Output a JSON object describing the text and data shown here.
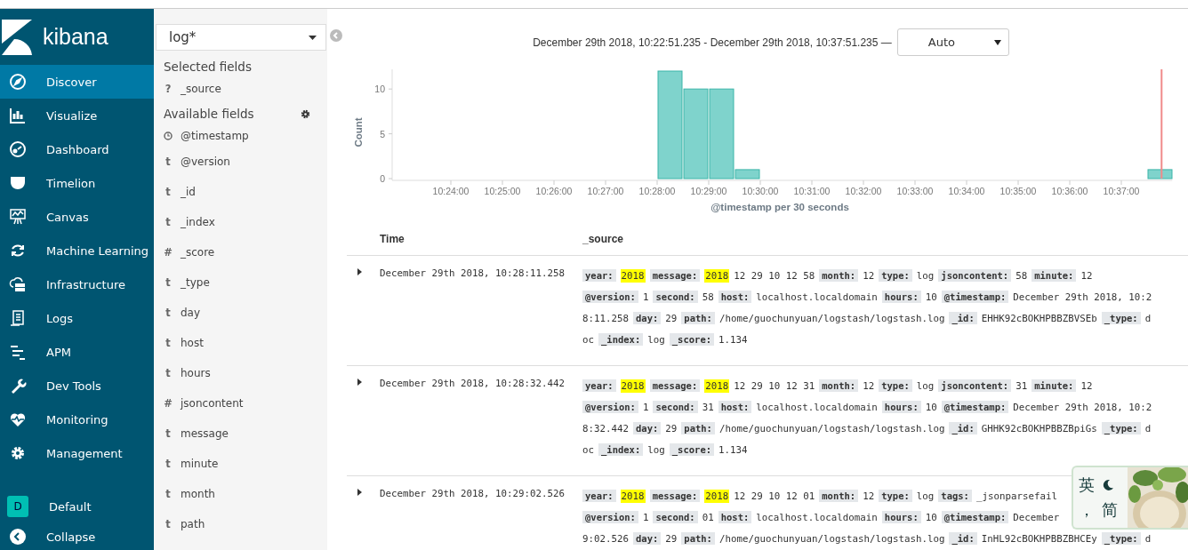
{
  "sidebar": {
    "logo_text": "kibana",
    "items": [
      {
        "label": "Discover",
        "selected": true
      },
      {
        "label": "Visualize",
        "selected": false
      },
      {
        "label": "Dashboard",
        "selected": false
      },
      {
        "label": "Timelion",
        "selected": false
      },
      {
        "label": "Canvas",
        "selected": false
      },
      {
        "label": "Machine Learning",
        "selected": false
      },
      {
        "label": "Infrastructure",
        "selected": false
      },
      {
        "label": "Logs",
        "selected": false
      },
      {
        "label": "APM",
        "selected": false
      },
      {
        "label": "Dev Tools",
        "selected": false
      },
      {
        "label": "Monitoring",
        "selected": false
      },
      {
        "label": "Management",
        "selected": false
      }
    ],
    "space": {
      "initial": "D",
      "label": "Default"
    },
    "collapse_label": "Collapse"
  },
  "fields_panel": {
    "index_pattern": "log*",
    "selected_heading": "Selected fields",
    "selected_fields": [
      {
        "kind": "typed",
        "symbol": "?",
        "name": "_source"
      }
    ],
    "available_heading": "Available fields",
    "available_fields": [
      {
        "kind": "date",
        "name": "@timestamp"
      },
      {
        "kind": "typed",
        "symbol": "t",
        "name": "@version"
      },
      {
        "kind": "typed",
        "symbol": "t",
        "name": "_id"
      },
      {
        "kind": "typed",
        "symbol": "t",
        "name": "_index"
      },
      {
        "kind": "typed",
        "symbol": "#",
        "name": "_score"
      },
      {
        "kind": "typed",
        "symbol": "t",
        "name": "_type"
      },
      {
        "kind": "typed",
        "symbol": "t",
        "name": "day"
      },
      {
        "kind": "typed",
        "symbol": "t",
        "name": "host"
      },
      {
        "kind": "typed",
        "symbol": "t",
        "name": "hours"
      },
      {
        "kind": "typed",
        "symbol": "#",
        "name": "jsoncontent"
      },
      {
        "kind": "typed",
        "symbol": "t",
        "name": "message"
      },
      {
        "kind": "typed",
        "symbol": "t",
        "name": "minute"
      },
      {
        "kind": "typed",
        "symbol": "t",
        "name": "month"
      },
      {
        "kind": "typed",
        "symbol": "t",
        "name": "path"
      }
    ]
  },
  "histogram": {
    "time_range": "December 29th 2018, 10:22:51.235 - December 29th 2018, 10:37:51.235 —",
    "interval": "Auto",
    "chart_data": {
      "type": "bar",
      "ylabel": "Count",
      "xlabel": "@timestamp per 30 seconds",
      "categories": [
        null,
        null,
        "10:24:00",
        null,
        "10:25:00",
        null,
        "10:26:00",
        null,
        "10:27:00",
        null,
        "10:28:00",
        null,
        "10:29:00",
        null,
        "10:30:00",
        null,
        "10:31:00",
        null,
        "10:32:00",
        null,
        "10:33:00",
        null,
        "10:34:00",
        null,
        "10:35:00",
        null,
        "10:36:00",
        null,
        "10:37:00",
        null
      ],
      "series": [
        {
          "color": "#7fd3cc",
          "values": [
            0,
            0,
            0,
            0,
            0,
            0,
            0,
            0,
            0,
            0,
            12,
            10,
            10,
            1,
            0,
            0,
            0,
            0,
            0,
            0,
            0,
            0,
            0,
            0,
            0,
            0,
            0,
            0,
            0,
            1
          ]
        }
      ],
      "ylim": [
        0,
        12
      ],
      "yticks": [
        0,
        5,
        10
      ]
    }
  },
  "table": {
    "columns": [
      "Time",
      "_source"
    ],
    "rows": [
      {
        "time": "December 29th 2018, 10:28:11.258",
        "lines": [
          [
            {
              "kind": "key",
              "text": "year:"
            },
            {
              "kind": "mark",
              "text": "2018"
            },
            {
              "kind": "key",
              "text": "message:"
            },
            {
              "kind": "mark",
              "text": "2018"
            },
            {
              "kind": "value",
              "text": "12 29 10 12 58"
            },
            {
              "kind": "key",
              "text": "month:"
            },
            {
              "kind": "value",
              "text": "12"
            },
            {
              "kind": "key",
              "text": "type:"
            },
            {
              "kind": "value",
              "text": "log"
            },
            {
              "kind": "key",
              "text": "jsoncontent:"
            },
            {
              "kind": "value",
              "text": "58"
            },
            {
              "kind": "key",
              "text": "minute:"
            },
            {
              "kind": "value",
              "text": "12"
            }
          ],
          [
            {
              "kind": "key",
              "text": "@version:"
            },
            {
              "kind": "value",
              "text": "1"
            },
            {
              "kind": "key",
              "text": "second:"
            },
            {
              "kind": "value",
              "text": "58"
            },
            {
              "kind": "key",
              "text": "host:"
            },
            {
              "kind": "value",
              "text": "localhost.localdomain"
            },
            {
              "kind": "key",
              "text": "hours:"
            },
            {
              "kind": "value",
              "text": "10"
            },
            {
              "kind": "key",
              "text": "@timestamp:"
            },
            {
              "kind": "value",
              "text": "December 29th 2018, 10:2"
            }
          ],
          [
            {
              "kind": "value",
              "text": "8:11.258"
            },
            {
              "kind": "key",
              "text": "day:"
            },
            {
              "kind": "value",
              "text": "29"
            },
            {
              "kind": "key",
              "text": "path:"
            },
            {
              "kind": "value",
              "text": "/home/guochunyuan/logstash/logstash.log"
            },
            {
              "kind": "key",
              "text": "_id:"
            },
            {
              "kind": "value",
              "text": "EHHK92cBOKHPBBZBVSEb"
            },
            {
              "kind": "key",
              "text": "_type:"
            },
            {
              "kind": "value",
              "text": "d"
            }
          ],
          [
            {
              "kind": "value",
              "text": "oc"
            },
            {
              "kind": "key",
              "text": "_index:"
            },
            {
              "kind": "value",
              "text": "log"
            },
            {
              "kind": "key",
              "text": "_score:"
            },
            {
              "kind": "value",
              "text": "1.134"
            }
          ]
        ]
      },
      {
        "time": "December 29th 2018, 10:28:32.442",
        "lines": [
          [
            {
              "kind": "key",
              "text": "year:"
            },
            {
              "kind": "mark",
              "text": "2018"
            },
            {
              "kind": "key",
              "text": "message:"
            },
            {
              "kind": "mark",
              "text": "2018"
            },
            {
              "kind": "value",
              "text": "12 29 10 12 31"
            },
            {
              "kind": "key",
              "text": "month:"
            },
            {
              "kind": "value",
              "text": "12"
            },
            {
              "kind": "key",
              "text": "type:"
            },
            {
              "kind": "value",
              "text": "log"
            },
            {
              "kind": "key",
              "text": "jsoncontent:"
            },
            {
              "kind": "value",
              "text": "31"
            },
            {
              "kind": "key",
              "text": "minute:"
            },
            {
              "kind": "value",
              "text": "12"
            }
          ],
          [
            {
              "kind": "key",
              "text": "@version:"
            },
            {
              "kind": "value",
              "text": "1"
            },
            {
              "kind": "key",
              "text": "second:"
            },
            {
              "kind": "value",
              "text": "31"
            },
            {
              "kind": "key",
              "text": "host:"
            },
            {
              "kind": "value",
              "text": "localhost.localdomain"
            },
            {
              "kind": "key",
              "text": "hours:"
            },
            {
              "kind": "value",
              "text": "10"
            },
            {
              "kind": "key",
              "text": "@timestamp:"
            },
            {
              "kind": "value",
              "text": "December 29th 2018, 10:2"
            }
          ],
          [
            {
              "kind": "value",
              "text": "8:32.442"
            },
            {
              "kind": "key",
              "text": "day:"
            },
            {
              "kind": "value",
              "text": "29"
            },
            {
              "kind": "key",
              "text": "path:"
            },
            {
              "kind": "value",
              "text": "/home/guochunyuan/logstash/logstash.log"
            },
            {
              "kind": "key",
              "text": "_id:"
            },
            {
              "kind": "value",
              "text": "GHHK92cBOKHPBBZBpiGs"
            },
            {
              "kind": "key",
              "text": "_type:"
            },
            {
              "kind": "value",
              "text": "d"
            }
          ],
          [
            {
              "kind": "value",
              "text": "oc"
            },
            {
              "kind": "key",
              "text": "_index:"
            },
            {
              "kind": "value",
              "text": "log"
            },
            {
              "kind": "key",
              "text": "_score:"
            },
            {
              "kind": "value",
              "text": "1.134"
            }
          ]
        ]
      },
      {
        "time": "December 29th 2018, 10:29:02.526",
        "lines": [
          [
            {
              "kind": "key",
              "text": "year:"
            },
            {
              "kind": "mark",
              "text": "2018"
            },
            {
              "kind": "key",
              "text": "message:"
            },
            {
              "kind": "mark",
              "text": "2018"
            },
            {
              "kind": "value",
              "text": "12 29 10 12 01"
            },
            {
              "kind": "key",
              "text": "month:"
            },
            {
              "kind": "value",
              "text": "12"
            },
            {
              "kind": "key",
              "text": "type:"
            },
            {
              "kind": "value",
              "text": "log"
            },
            {
              "kind": "key",
              "text": "tags:"
            },
            {
              "kind": "value",
              "text": "_jsonparsefail"
            }
          ],
          [
            {
              "kind": "key",
              "text": "@version:"
            },
            {
              "kind": "value",
              "text": "1"
            },
            {
              "kind": "key",
              "text": "second:"
            },
            {
              "kind": "value",
              "text": "01"
            },
            {
              "kind": "key",
              "text": "host:"
            },
            {
              "kind": "value",
              "text": "localhost.localdomain"
            },
            {
              "kind": "key",
              "text": "hours:"
            },
            {
              "kind": "value",
              "text": "10"
            },
            {
              "kind": "key",
              "text": "@timestamp:"
            },
            {
              "kind": "value",
              "text": "December"
            }
          ],
          [
            {
              "kind": "value",
              "text": "9:02.526"
            },
            {
              "kind": "key",
              "text": "day:"
            },
            {
              "kind": "value",
              "text": "29"
            },
            {
              "kind": "key",
              "text": "path:"
            },
            {
              "kind": "value",
              "text": "/home/guochunyuan/logstash/logstash.log"
            },
            {
              "kind": "key",
              "text": "_id:"
            },
            {
              "kind": "value",
              "text": "InHL92cBOKHPBBZBHCEy"
            },
            {
              "kind": "key",
              "text": "_type:"
            },
            {
              "kind": "value",
              "text": "d"
            }
          ]
        ]
      }
    ]
  },
  "ime_toolbar": {
    "language": "英",
    "punctuation": "，",
    "script": "简"
  }
}
